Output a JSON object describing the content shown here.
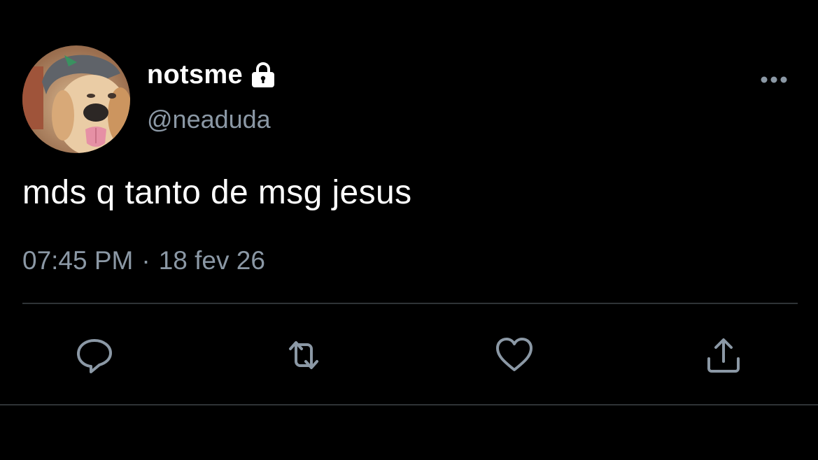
{
  "author": {
    "display_name": "notsme",
    "handle": "@neaduda",
    "verified_lock_icon": "lock-icon"
  },
  "tweet": {
    "text": "mds q tanto de msg jesus",
    "time": "07:45 PM",
    "separator": "·",
    "date": "18 fev 26"
  },
  "actions": {
    "reply_icon": "reply-icon",
    "retweet_icon": "retweet-icon",
    "like_icon": "heart-icon",
    "share_icon": "share-icon",
    "more_icon": "more-icon"
  },
  "colors": {
    "background": "#000000",
    "primary_text": "#ffffff",
    "secondary_text": "#8b98a5",
    "divider": "#2f3336",
    "icon": "#8b98a5"
  }
}
